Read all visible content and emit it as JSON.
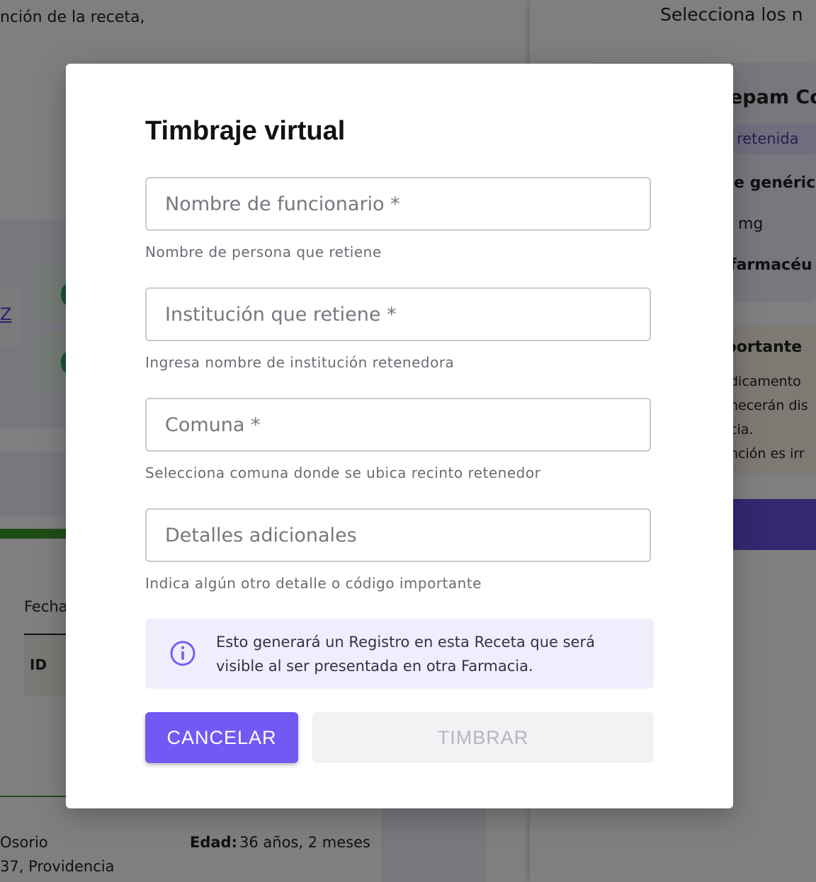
{
  "background": {
    "left_top_text": "nción de la receta,",
    "left_link": "Z",
    "left_table_label": "Fecha",
    "left_table_id": "ID",
    "left_bottom_name": "Osorio",
    "left_bottom_address": "37, Providencia",
    "left_age_label": "Edad:",
    "left_age_value": "36 años, 2 meses",
    "right_top_text": "Selecciona los n",
    "right_drug_name": "epam Co",
    "right_badge": "retenida",
    "right_generic": "e genéric",
    "right_dose": "mg",
    "right_farma": "farmacéu",
    "right_warn_title": "portante",
    "right_warn_line1": "dicamento",
    "right_warn_line2": "necerán dis",
    "right_warn_line3": "cia.",
    "right_warn_line4": "nción es irr"
  },
  "modal": {
    "title": "Timbraje virtual",
    "fields": [
      {
        "placeholder": "Nombre de funcionario *",
        "value": "",
        "helper": "Nombre de persona que retiene"
      },
      {
        "placeholder": "Institución que retiene *",
        "value": "",
        "helper": "Ingresa nombre de institución retenedora"
      },
      {
        "placeholder": "Comuna *",
        "value": "",
        "helper": "Selecciona comuna donde se ubica recinto retenedor"
      },
      {
        "placeholder": "Detalles adicionales",
        "value": "",
        "helper": "Indica algún otro detalle o código importante"
      }
    ],
    "info_icon": "info-circle-icon",
    "info_text": "Esto generará un Registro en esta Receta que será visible al ser presentada en otra Farmacia.",
    "cancel_label": "CANCELAR",
    "submit_label": "TIMBRAR",
    "colors": {
      "primary": "#7458f4",
      "info_bg": "#f0eefc",
      "disabled_bg": "#f2f2f5",
      "disabled_text": "#b5b5bd"
    }
  }
}
